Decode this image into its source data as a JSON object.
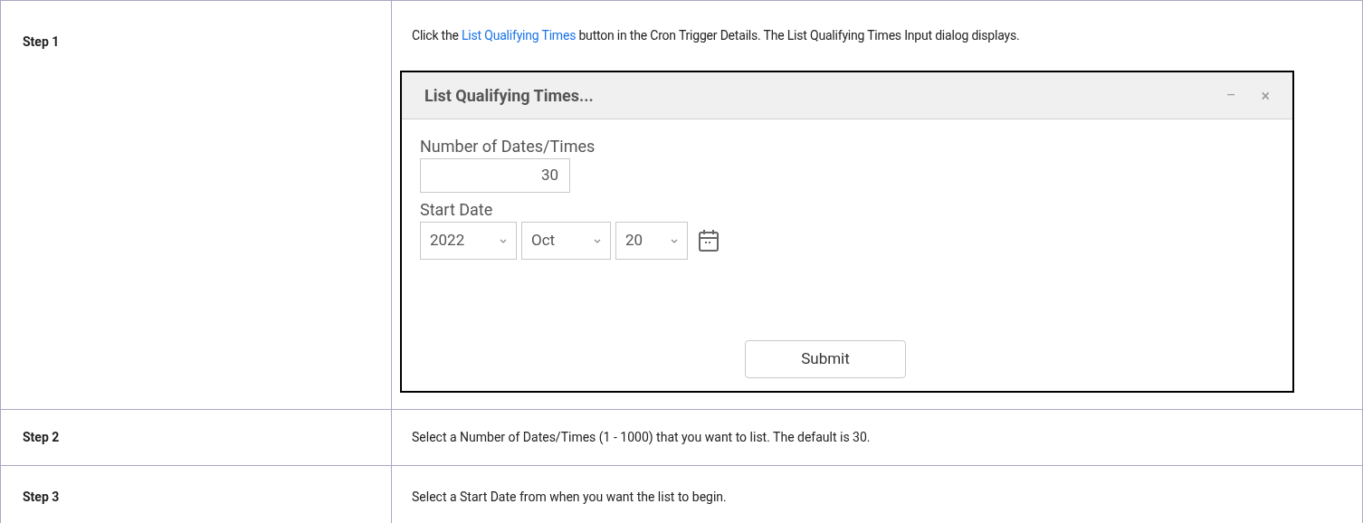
{
  "steps": [
    {
      "label": "Step 1",
      "text_before": "Click the ",
      "link": "List Qualifying Times",
      "text_after": " button in the Cron Trigger Details. The List Qualifying Times Input dialog displays.",
      "dialog": {
        "title": "List Qualifying Times...",
        "minimize": "–",
        "close": "×",
        "number_label": "Number of Dates/Times",
        "number_value": "30",
        "date_label": "Start Date",
        "year": "2022",
        "month": "Oct",
        "day": "20",
        "submit": "Submit"
      }
    },
    {
      "label": "Step 2",
      "text": "Select a Number of Dates/Times (1 - 1000) that you want to list. The default is 30."
    },
    {
      "label": "Step 3",
      "text": "Select a Start Date from when you want the list to begin."
    }
  ]
}
